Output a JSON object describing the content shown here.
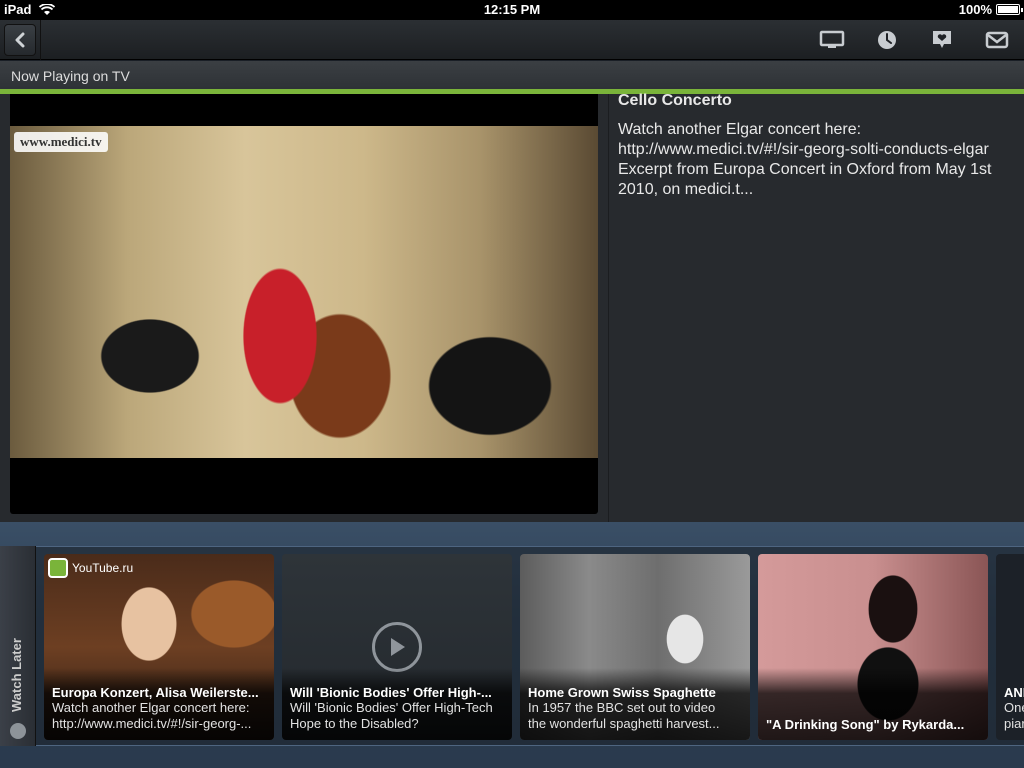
{
  "status_bar": {
    "device": "iPad",
    "time": "12:15 PM",
    "battery": "100%",
    "battery_level": 1.0
  },
  "toolbar": {
    "icons": [
      "back-icon",
      "tv-icon",
      "clock-icon",
      "heart-icon",
      "mail-icon"
    ]
  },
  "now_playing": {
    "label": "Now Playing on TV"
  },
  "video": {
    "watermark": "www.medici.tv"
  },
  "details": {
    "title": "Cello Concerto",
    "description": "Watch another Elgar concert here:\nhttp://www.medici.tv/#!/sir-georg-solti-conducts-elgar\nExcerpt from Europa Concert in Oxford from May 1st\n2010, on medici.t..."
  },
  "watch_later": {
    "label": "Watch Later",
    "cards": [
      {
        "source": "YouTube.ru",
        "title": "Europa Konzert, Alisa Weilerste...",
        "description": "Watch another Elgar concert here:\nhttp://www.medici.tv/#!/sir-georg-..."
      },
      {
        "title": "Will 'Bionic Bodies' Offer High-...",
        "description": "Will 'Bionic Bodies' Offer High-Tech\nHope to the Disabled?"
      },
      {
        "title": "Home Grown Swiss Spaghette",
        "description": "In 1957 the BBC set out to video\nthe wonderful spaghetti harvest..."
      },
      {
        "title": "\"A Drinking Song\" by Rykarda...",
        "description": ""
      },
      {
        "title": "ANI",
        "description": "One\npiar"
      }
    ]
  },
  "colors": {
    "accent_green": "#7ab43a",
    "toolbar_bg": "#2b2f33",
    "shelf_bg": "#3a4f66"
  }
}
